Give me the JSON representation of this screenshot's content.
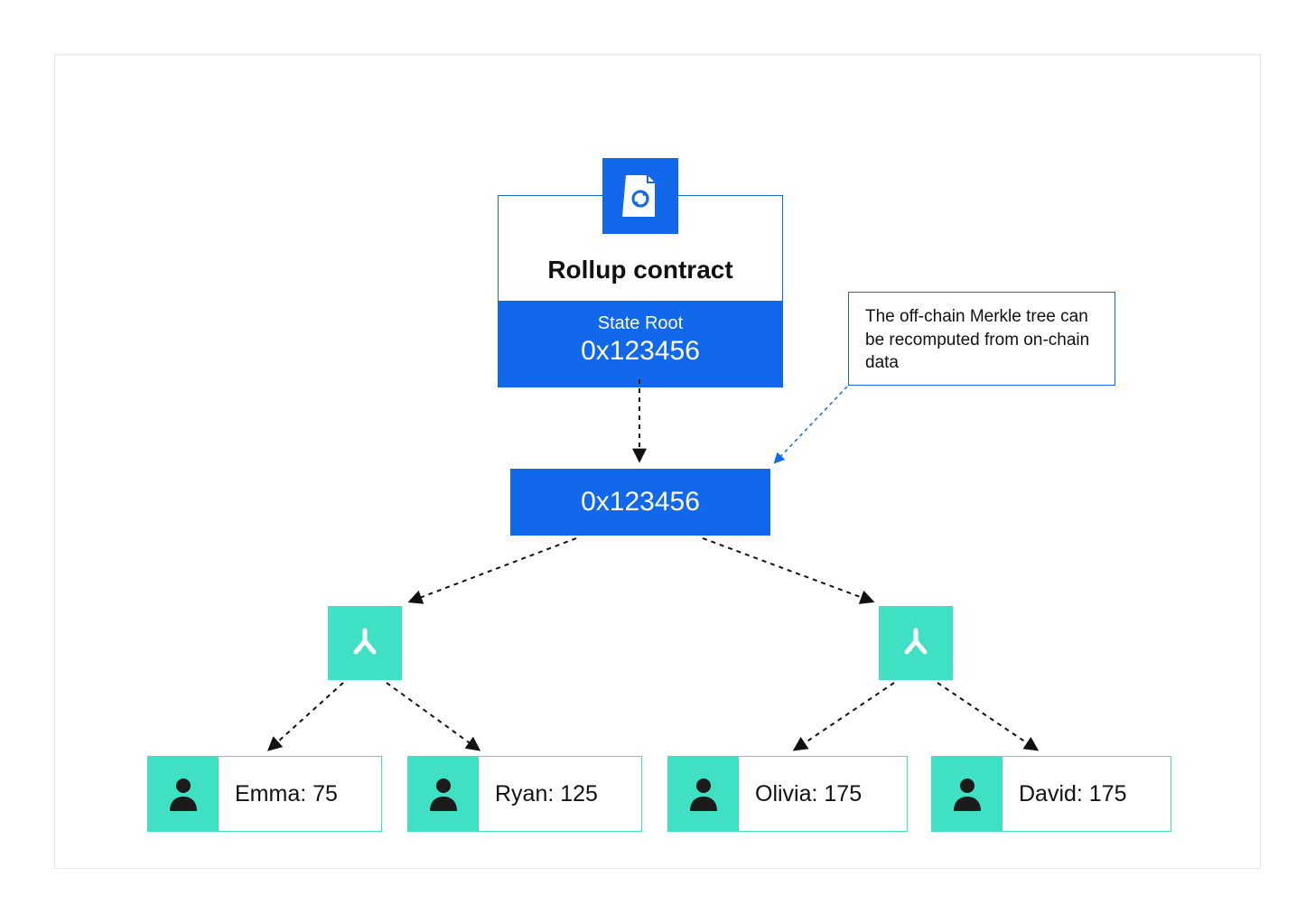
{
  "contract": {
    "title": "Rollup contract",
    "state_label": "State Root",
    "state_hash": "0x123456"
  },
  "callout": {
    "text": "The off-chain Merkle tree can be recomputed from on-chain data"
  },
  "merkle_root": {
    "hash": "0x123456"
  },
  "leaves": [
    {
      "label": "Emma: 75"
    },
    {
      "label": "Ryan: 125"
    },
    {
      "label": "Olivia: 175"
    },
    {
      "label": "David: 175"
    }
  ],
  "colors": {
    "accent_blue": "#1268eb",
    "accent_teal": "#3fe0c4",
    "border_light": "#e4e6ea"
  }
}
